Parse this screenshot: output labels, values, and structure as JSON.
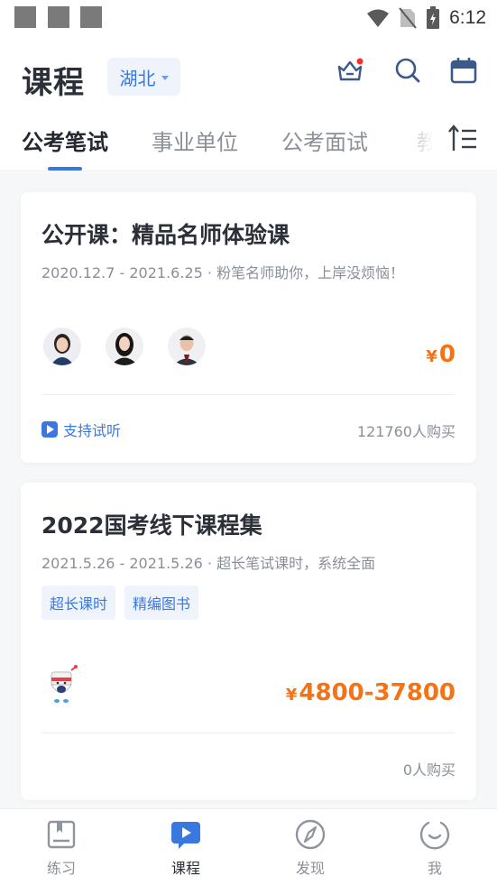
{
  "status_bar": {
    "time": "6:12"
  },
  "header": {
    "title": "课程",
    "region": "湖北"
  },
  "tabs": [
    {
      "label": "公考笔试",
      "active": true
    },
    {
      "label": "事业单位",
      "active": false
    },
    {
      "label": "公考面试",
      "active": false
    },
    {
      "label": "教",
      "active": false
    }
  ],
  "courses": [
    {
      "title": "公开课：精品名师体验课",
      "subtitle": "2020.12.7 - 2021.6.25 · 粉笔名师助你，上岸没烦恼！",
      "currency": "¥",
      "price": "0",
      "trial_label": "支持试听",
      "buy_count": "121760人购买"
    },
    {
      "title": "2022国考线下课程集",
      "subtitle": "2021.5.26 - 2021.5.26 · 超长笔试课时，系统全面",
      "tags": [
        "超长课时",
        "精编图书"
      ],
      "currency": "¥",
      "price": "4800-37800",
      "buy_count": "0人购买"
    }
  ],
  "bottom_nav": [
    {
      "label": "练习",
      "icon": "book-icon",
      "active": false
    },
    {
      "label": "课程",
      "icon": "play-icon",
      "active": true
    },
    {
      "label": "发现",
      "icon": "compass-icon",
      "active": false
    },
    {
      "label": "我",
      "icon": "smile-icon",
      "active": false
    }
  ],
  "colors": {
    "accent": "#3a78e0",
    "price": "#f57314",
    "notification": "#ff2d2d"
  }
}
